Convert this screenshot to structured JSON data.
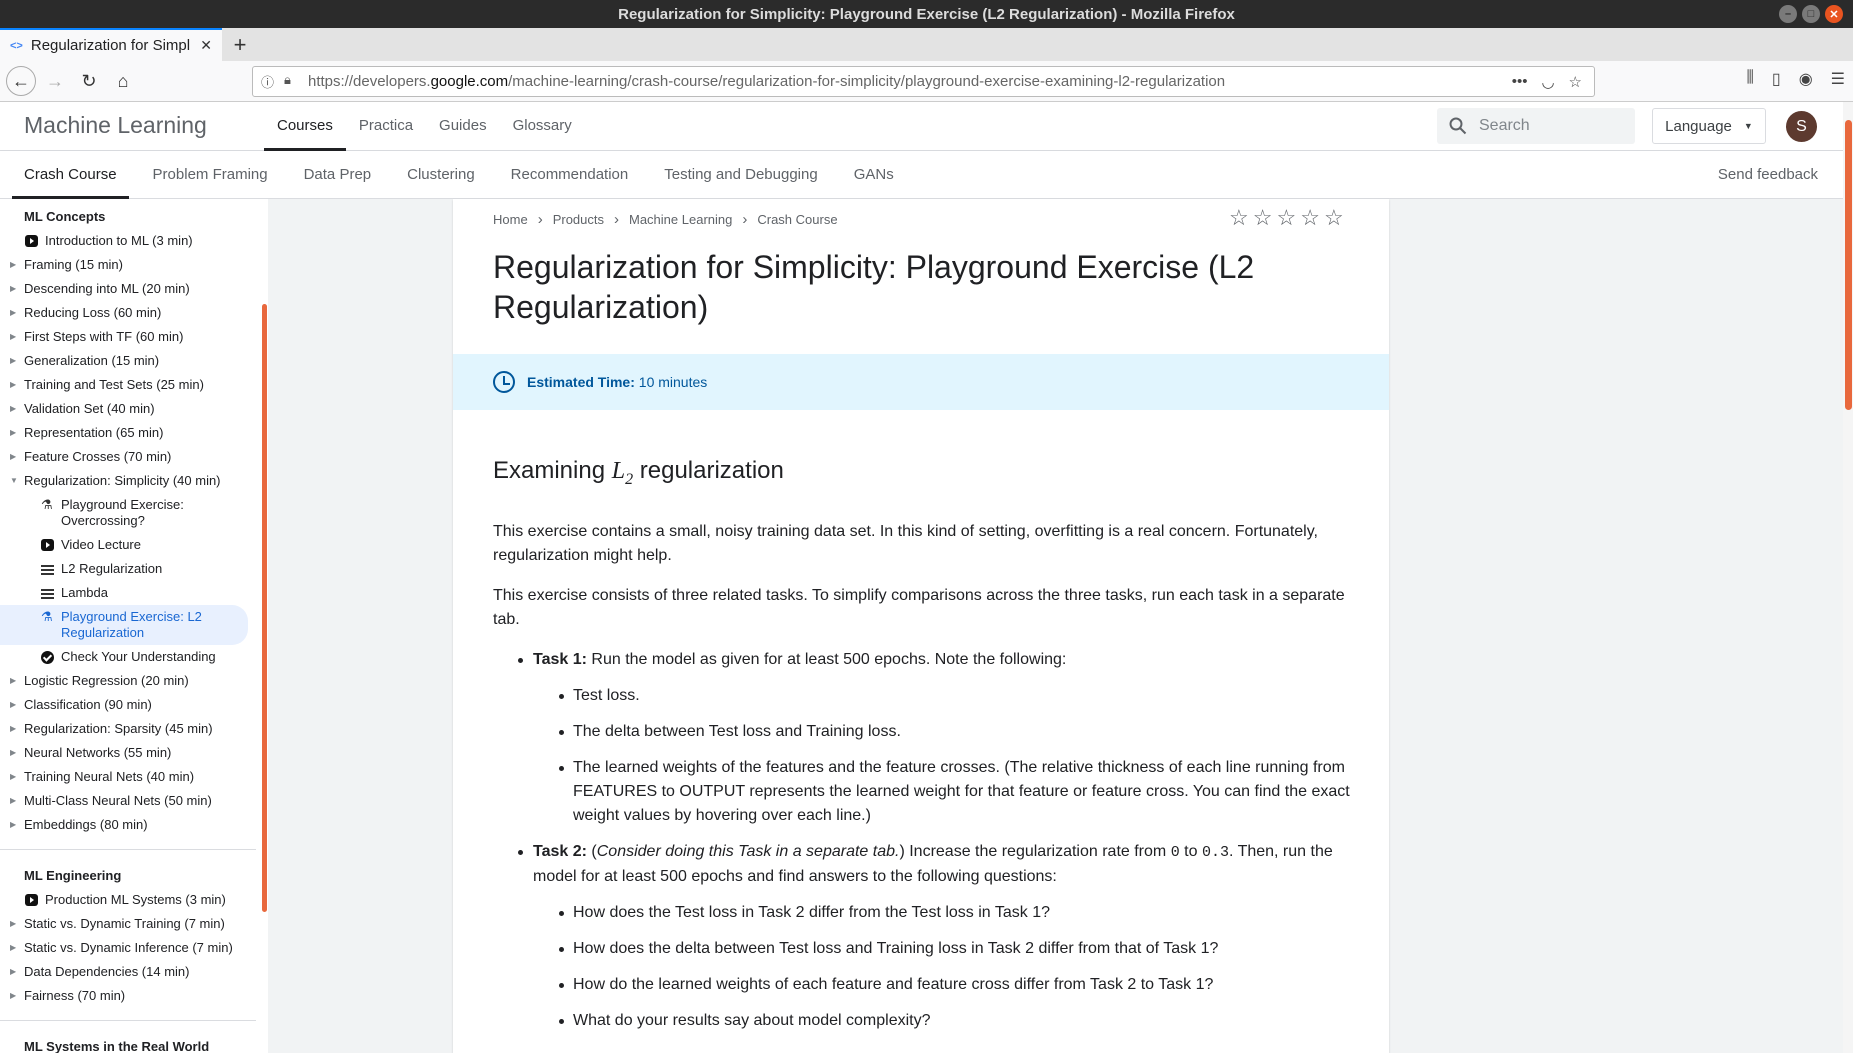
{
  "window": {
    "title": "Regularization for Simplicity: Playground Exercise (L2 Regularization) - Mozilla Firefox"
  },
  "browser": {
    "tab_title": "Regularization for Simpl",
    "url_prefix": "https://developers.",
    "url_host": "google.com",
    "url_path": "/machine-learning/crash-course/regularization-for-simplicity/playground-exercise-examining-l2-regularization"
  },
  "site": {
    "logo": "Machine Learning",
    "top_nav": [
      "Courses",
      "Practica",
      "Guides",
      "Glossary"
    ],
    "search_placeholder": "Search",
    "language_label": "Language",
    "avatar_letter": "S"
  },
  "sub_nav": {
    "tabs": [
      "Crash Course",
      "Problem Framing",
      "Data Prep",
      "Clustering",
      "Recommendation",
      "Testing and Debugging",
      "GANs"
    ],
    "feedback": "Send feedback"
  },
  "sidebar": {
    "section1": "ML Concepts",
    "items": [
      "Introduction to ML (3 min)",
      "Framing (15 min)",
      "Descending into ML (20 min)",
      "Reducing Loss (60 min)",
      "First Steps with TF (60 min)",
      "Generalization (15 min)",
      "Training and Test Sets (25 min)",
      "Validation Set (40 min)",
      "Representation (65 min)",
      "Feature Crosses (70 min)",
      "Regularization: Simplicity (40 min)"
    ],
    "subitems": [
      "Playground Exercise: Overcrossing?",
      "Video Lecture",
      "L2 Regularization",
      "Lambda",
      "Playground Exercise: L2 Regularization",
      "Check Your Understanding"
    ],
    "items2": [
      "Logistic Regression (20 min)",
      "Classification (90 min)",
      "Regularization: Sparsity (45 min)",
      "Neural Networks (55 min)",
      "Training Neural Nets (40 min)",
      "Multi-Class Neural Nets (50 min)",
      "Embeddings (80 min)"
    ],
    "section2": "ML Engineering",
    "items3": [
      "Production ML Systems (3 min)",
      "Static vs. Dynamic Training (7 min)",
      "Static vs. Dynamic Inference (7 min)",
      "Data Dependencies (14 min)",
      "Fairness (70 min)"
    ],
    "section3": "ML Systems in the Real World"
  },
  "breadcrumb": [
    "Home",
    "Products",
    "Machine Learning",
    "Crash Course"
  ],
  "rating": {
    "stars_filled": 0,
    "stars_total": 5
  },
  "article": {
    "title": "Regularization for Simplicity: Playground Exercise (L2 Regularization)",
    "time_label": "Estimated Time:",
    "time_value": "10 minutes",
    "heading_pre": "Examining",
    "heading_L": "L",
    "heading_sub": "2",
    "heading_post": "regularization",
    "p1": "This exercise contains a small, noisy training data set. In this kind of setting, overfitting is a real concern. Fortunately, regularization might help.",
    "p2": "This exercise consists of three related tasks. To simplify comparisons across the three tasks, run each task in a separate tab.",
    "task1_label": "Task 1:",
    "task1_text": "Run the model as given for at least 500 epochs. Note the following:",
    "task1_items": [
      "Test loss.",
      "The delta between Test loss and Training loss.",
      "The learned weights of the features and the feature crosses. (The relative thickness of each line running from FEATURES to OUTPUT represents the learned weight for that feature or feature cross. You can find the exact weight values by hovering over each line.)"
    ],
    "task2_label": "Task 2:",
    "task2_italic": "Consider doing this Task in a separate tab.",
    "task2_a": "Increase the regularization rate from",
    "task2_code1": "0",
    "task2_b": "to",
    "task2_code2": "0.3",
    "task2_c": ". Then, run the model for at least 500 epochs and find answers to the following questions:",
    "task2_items": [
      "How does the Test loss in Task 2 differ from the Test loss in Task 1?",
      "How does the delta between Test loss and Training loss in Task 2 differ from that of Task 1?",
      "How do the learned weights of each feature and feature cross differ from Task 2 to Task 1?",
      "What do your results say about model complexity?"
    ]
  }
}
